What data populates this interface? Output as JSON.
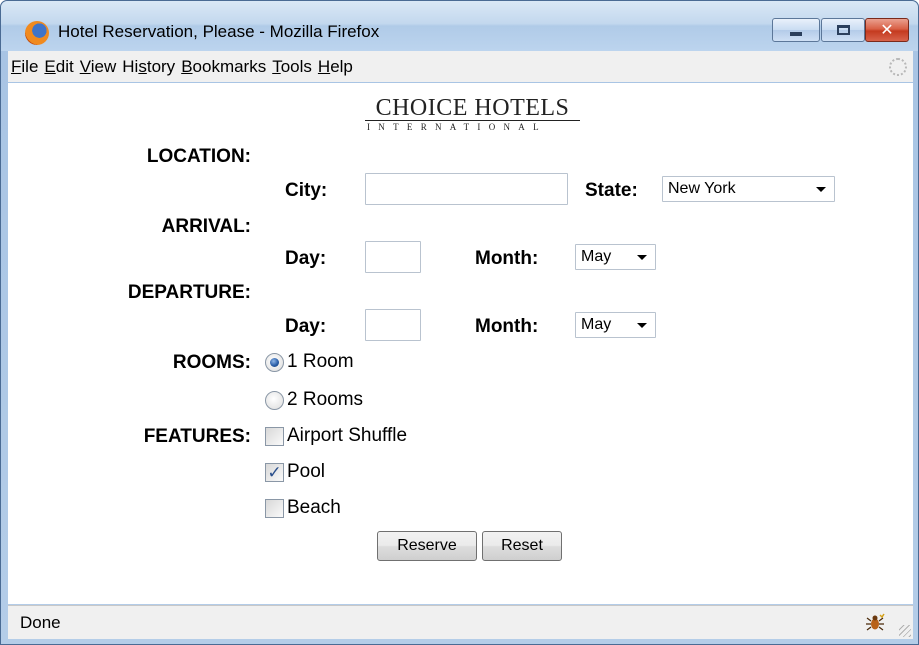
{
  "window": {
    "title": "Hotel Reservation, Please - Mozilla Firefox",
    "app_icon": "firefox-icon",
    "controls": {
      "minimize": "minimize-icon",
      "maximize": "maximize-icon",
      "close_glyph": "✕"
    }
  },
  "menubar": {
    "items": [
      {
        "label": "File"
      },
      {
        "label": "Edit"
      },
      {
        "label": "View"
      },
      {
        "label": "History"
      },
      {
        "label": "Bookmarks"
      },
      {
        "label": "Tools"
      },
      {
        "label": "Help"
      }
    ],
    "throbber_icon": "throbber-icon"
  },
  "logo": {
    "main": "CHOICE HOTELS",
    "sub": "INTERNATIONAL"
  },
  "form": {
    "location": {
      "label": "LOCATION:",
      "city_label": "City:",
      "city_value": "",
      "state_label": "State:",
      "state_value": "New York"
    },
    "arrival": {
      "label": "ARRIVAL:",
      "day_label": "Day:",
      "day_value": "",
      "month_label": "Month:",
      "month_value": "May"
    },
    "departure": {
      "label": "DEPARTURE:",
      "day_label": "Day:",
      "day_value": "",
      "month_label": "Month:",
      "month_value": "May"
    },
    "rooms": {
      "label": "ROOMS:",
      "options": [
        {
          "label": "1 Room",
          "checked": true
        },
        {
          "label": "2 Rooms",
          "checked": false
        }
      ]
    },
    "features": {
      "label": "FEATURES:",
      "options": [
        {
          "label": "Airport Shuffle",
          "checked": false
        },
        {
          "label": "Pool",
          "checked": true,
          "mark": "✓"
        },
        {
          "label": "Beach",
          "checked": false
        }
      ]
    },
    "reserve_label": "Reserve",
    "reset_label": "Reset"
  },
  "statusbar": {
    "text": "Done",
    "addon_icon": "bug-icon"
  }
}
